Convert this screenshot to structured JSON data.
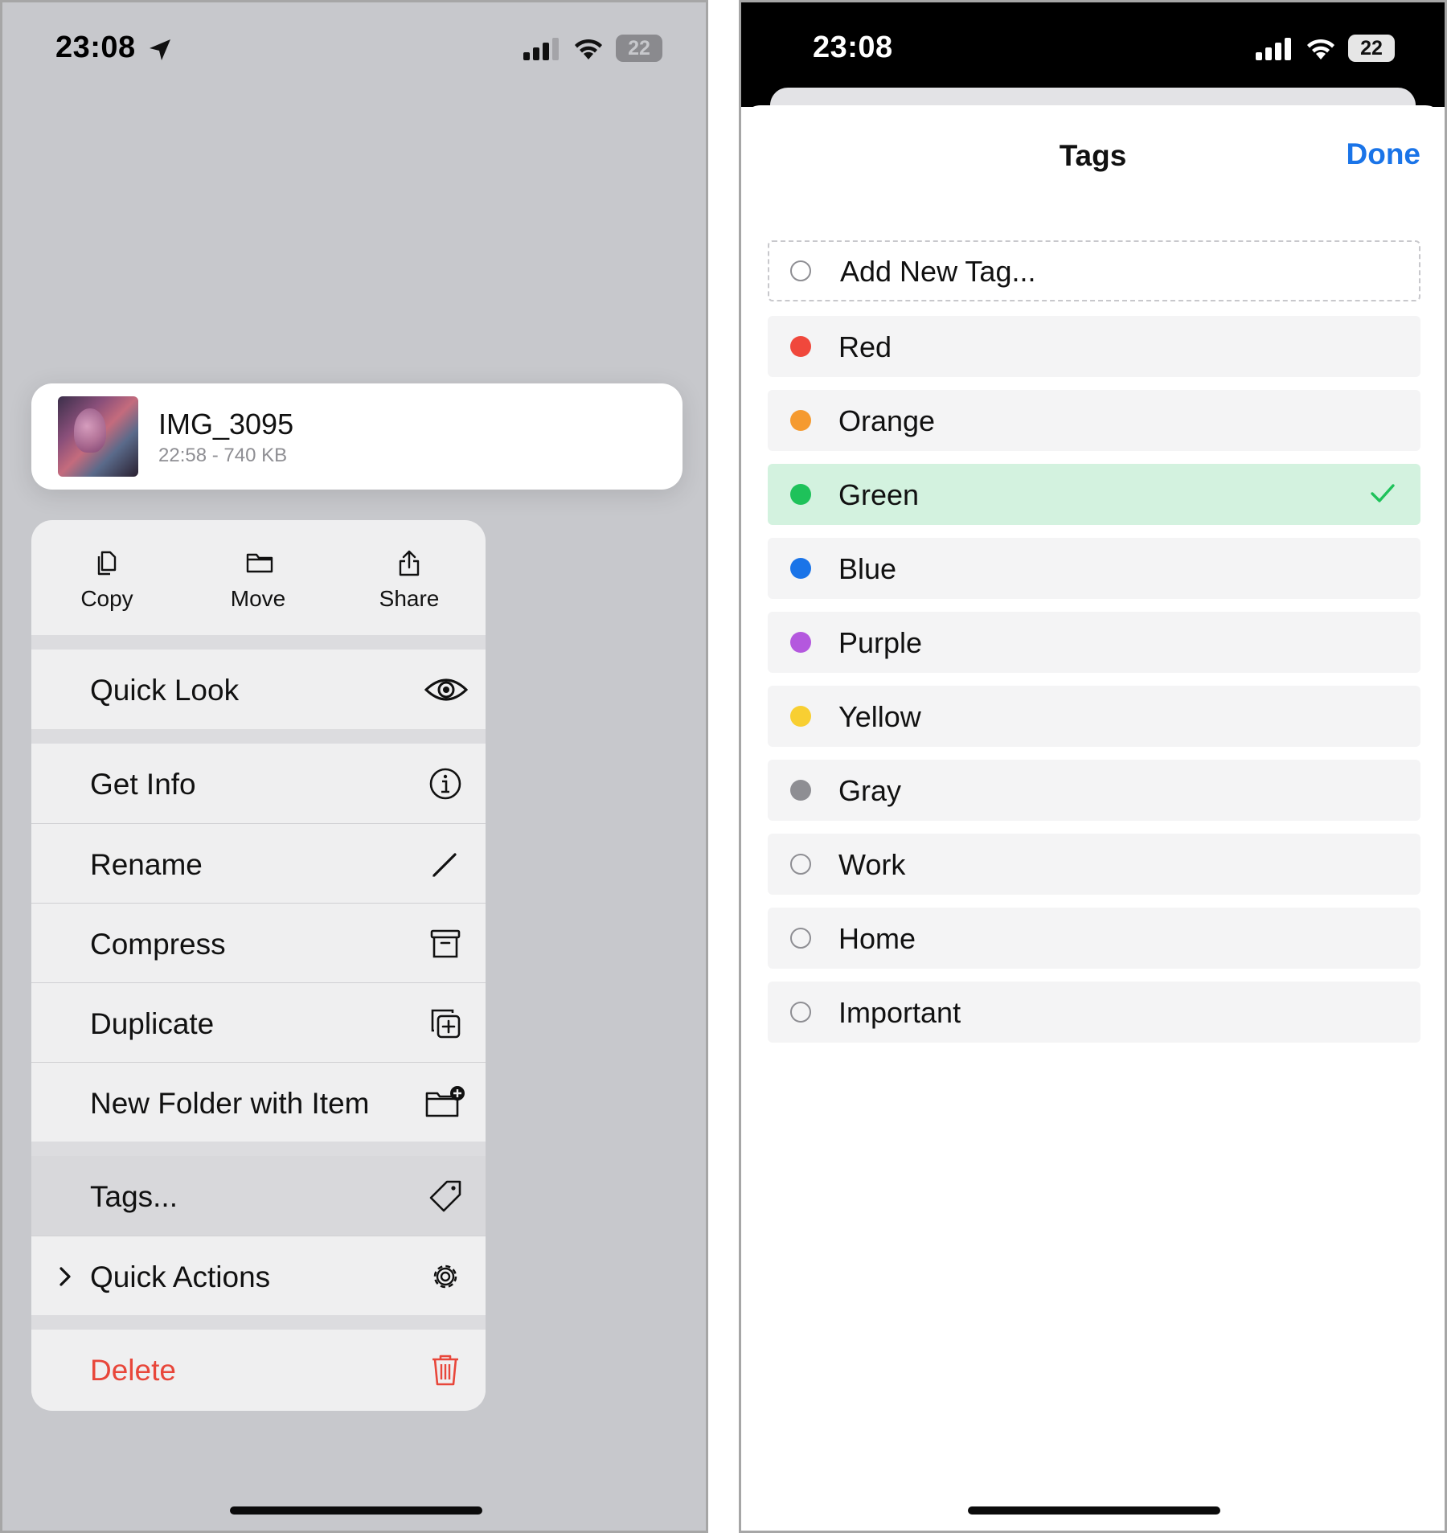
{
  "left_screen": {
    "status": {
      "time": "23:08",
      "battery": "22"
    },
    "file": {
      "name": "IMG_3095",
      "meta": "22:58 - 740 KB"
    },
    "top_actions": [
      {
        "label": "Copy",
        "icon": "copy-icon"
      },
      {
        "label": "Move",
        "icon": "folder-icon"
      },
      {
        "label": "Share",
        "icon": "share-icon"
      }
    ],
    "menu": {
      "quick_look": "Quick Look",
      "get_info": "Get Info",
      "rename": "Rename",
      "compress": "Compress",
      "duplicate": "Duplicate",
      "new_folder": "New Folder with Item",
      "tags": "Tags...",
      "quick_actions": "Quick Actions",
      "delete": "Delete"
    }
  },
  "right_screen": {
    "status": {
      "time": "23:08",
      "battery": "22"
    },
    "title": "Tags",
    "done": "Done",
    "add_tag": "Add New Tag...",
    "tags": [
      {
        "label": "Red",
        "color": "#f0483c",
        "filled": true,
        "selected": false
      },
      {
        "label": "Orange",
        "color": "#f59a2f",
        "filled": true,
        "selected": false
      },
      {
        "label": "Green",
        "color": "#1ec25a",
        "filled": true,
        "selected": true
      },
      {
        "label": "Blue",
        "color": "#1a74e8",
        "filled": true,
        "selected": false
      },
      {
        "label": "Purple",
        "color": "#b458de",
        "filled": true,
        "selected": false
      },
      {
        "label": "Yellow",
        "color": "#f8cf32",
        "filled": true,
        "selected": false
      },
      {
        "label": "Gray",
        "color": "#8e8e93",
        "filled": true,
        "selected": false
      },
      {
        "label": "Work",
        "color": "#8e8e93",
        "filled": false,
        "selected": false
      },
      {
        "label": "Home",
        "color": "#8e8e93",
        "filled": false,
        "selected": false
      },
      {
        "label": "Important",
        "color": "#8e8e93",
        "filled": false,
        "selected": false
      }
    ],
    "check_color": "#1ec25a"
  }
}
